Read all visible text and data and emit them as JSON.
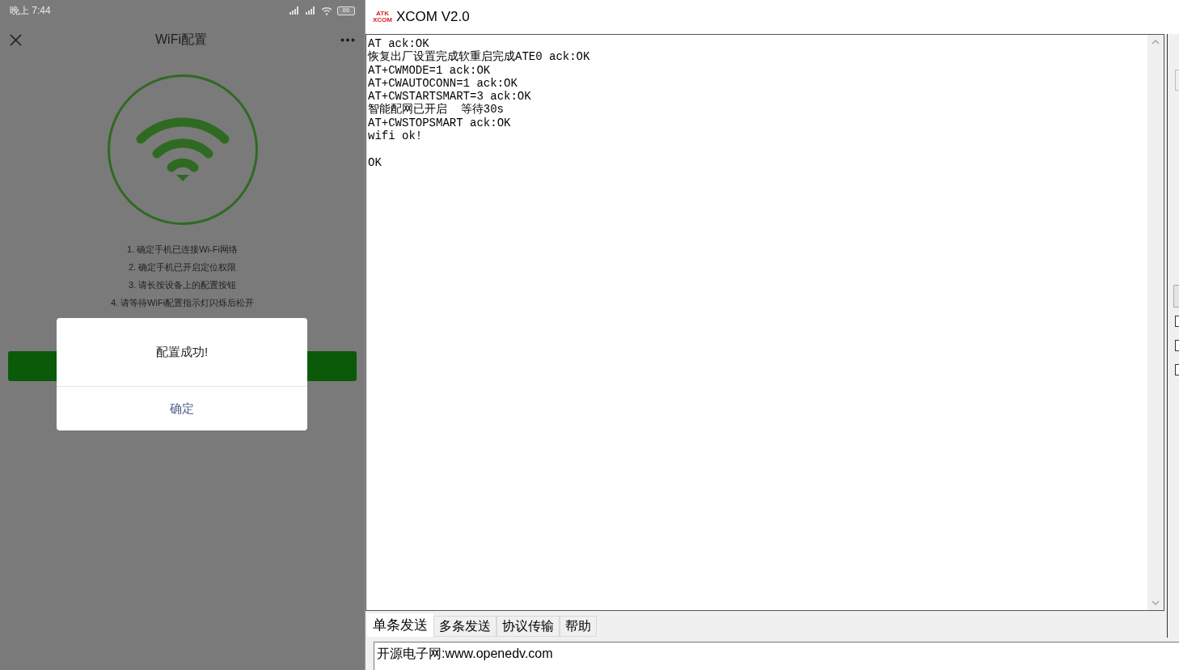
{
  "phone": {
    "status_bar": {
      "time": "晚上 7:44",
      "battery": "86"
    },
    "nav": {
      "title": "WiFi配置"
    },
    "steps": [
      "1. 确定手机已连接Wi-Fi网络",
      "2. 确定手机已开启定位权限",
      "3. 请长按设备上的配置按钮",
      "4. 请等待WiFi配置指示灯闪烁后松开"
    ],
    "dialog": {
      "message": "配置成功!",
      "button": "确定"
    }
  },
  "xcom": {
    "window": {
      "title": "XCOM V2.0",
      "logo_top": "ATK",
      "logo_bottom": "XCOM"
    },
    "receive_text": "AT ack:OK\n恢复出厂设置完成软重启完成ATE0 ack:OK\nAT+CWMODE=1 ack:OK\nAT+CWAUTOCONN=1 ack:OK\nAT+CWSTARTSMART=3 ack:OK\n智能配网已开启  等待30s\nAT+CWSTOPSMART ack:OK\nwifi ok!\n\nOK",
    "side_checkboxes": [
      {
        "checked": false
      },
      {
        "checked": false
      },
      {
        "checked": false
      }
    ],
    "tabs": [
      {
        "label": "单条发送",
        "selected": true
      },
      {
        "label": "多条发送",
        "selected": false
      },
      {
        "label": "协议传输",
        "selected": false
      },
      {
        "label": "帮助",
        "selected": false
      }
    ],
    "send_field": {
      "value": "开源电子网:www.openedv.com"
    }
  }
}
